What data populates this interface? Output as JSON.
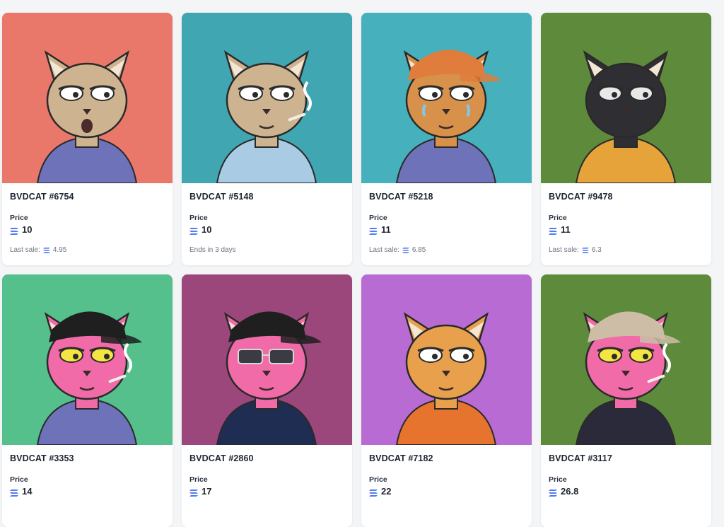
{
  "cards": [
    {
      "title": "BVDCAT #6754",
      "price_label": "Price",
      "price": "10",
      "meta_label": "Last sale:",
      "meta_value": "4.95",
      "has_sale": true,
      "bg": "#e9786b",
      "fur": "#cdb38f",
      "eye": "#ffffff",
      "hat": "",
      "shirt": "#6d72b9",
      "mood": "shock"
    },
    {
      "title": "BVDCAT #5148",
      "price_label": "Price",
      "price": "10",
      "meta_label": "Ends in 3 days",
      "meta_value": "",
      "has_sale": false,
      "bg": "#3fa6b2",
      "fur": "#cdb38f",
      "eye": "#ffffff",
      "hat": "",
      "shirt": "#a9cbe3",
      "mood": "smoke"
    },
    {
      "title": "BVDCAT #5218",
      "price_label": "Price",
      "price": "11",
      "meta_label": "Last sale:",
      "meta_value": "6.85",
      "has_sale": true,
      "bg": "#46b0bd",
      "fur": "#d7914a",
      "eye": "#ffffff",
      "hat": "#e07d3c",
      "shirt": "#6d72b9",
      "mood": "cry"
    },
    {
      "title": "BVDCAT #9478",
      "price_label": "Price",
      "price": "11",
      "meta_label": "Last sale:",
      "meta_value": "6.3",
      "has_sale": true,
      "bg": "#5e8a3c",
      "fur": "#2f2f33",
      "eye": "#e8e8e8",
      "hat": "",
      "shirt": "#e6a33a",
      "mood": "calm"
    },
    {
      "title": "BVDCAT #3353",
      "price_label": "Price",
      "price": "14",
      "meta_label": "",
      "meta_value": "",
      "has_sale": false,
      "bg": "#55c08b",
      "fur": "#f06ba8",
      "eye": "#f5e542",
      "hat": "#1f1f1f",
      "shirt": "#6d72b9",
      "mood": "smoke"
    },
    {
      "title": "BVDCAT #2860",
      "price_label": "Price",
      "price": "17",
      "meta_label": "",
      "meta_value": "",
      "has_sale": false,
      "bg": "#9b477c",
      "fur": "#f06ba8",
      "eye": "#2d2d2d",
      "hat": "#1f1f1f",
      "shirt": "#1f2d52",
      "mood": "glasses"
    },
    {
      "title": "BVDCAT #7182",
      "price_label": "Price",
      "price": "22",
      "meta_label": "",
      "meta_value": "",
      "has_sale": false,
      "bg": "#b86cd3",
      "fur": "#e9a04d",
      "eye": "#ffffff",
      "hat": "",
      "shirt": "#e6742e",
      "mood": "calm"
    },
    {
      "title": "BVDCAT #3117",
      "price_label": "Price",
      "price": "26.8",
      "meta_label": "",
      "meta_value": "",
      "has_sale": false,
      "bg": "#5e8a3c",
      "fur": "#f06ba8",
      "eye": "#f5e542",
      "hat": "#cdbda6",
      "shirt": "#2a2a3a",
      "mood": "smoke"
    }
  ],
  "icons": {
    "currency": "solana-icon"
  }
}
